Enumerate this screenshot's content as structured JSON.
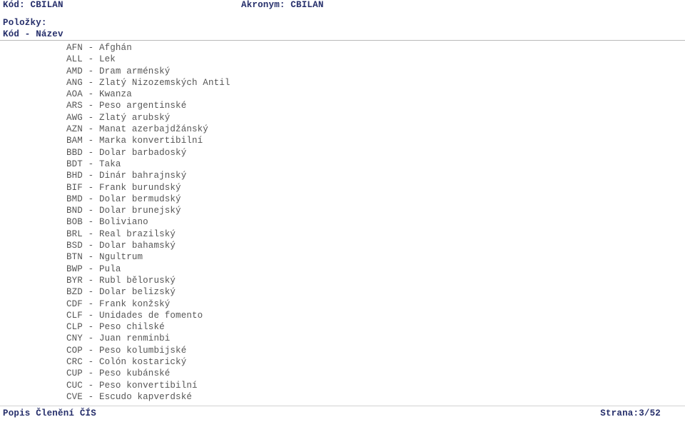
{
  "header": {
    "code_label": "Kód:",
    "code_value": "CBILAN",
    "code_line": "Kód: CBILAN",
    "acronym_label": "Akronym:",
    "acronym_value": "CBILAN",
    "acronym_line": "Akronym: CBILAN",
    "items_label": "Položky:",
    "column_header": "Kód - Název"
  },
  "items": [
    {
      "code": "AFN",
      "sep": " - ",
      "name": "Afghán",
      "text": "AFN - Afghán"
    },
    {
      "code": "ALL",
      "sep": " - ",
      "name": "Lek",
      "text": "ALL - Lek"
    },
    {
      "code": "AMD",
      "sep": " - ",
      "name": "Dram arménský",
      "text": "AMD - Dram arménský"
    },
    {
      "code": "ANG",
      "sep": " - ",
      "name": "Zlatý Nizozemských Antil",
      "text": "ANG - Zlatý Nizozemských Antil"
    },
    {
      "code": "AOA",
      "sep": " - ",
      "name": "Kwanza",
      "text": "AOA - Kwanza"
    },
    {
      "code": "ARS",
      "sep": " - ",
      "name": "Peso argentinské",
      "text": "ARS - Peso argentinské"
    },
    {
      "code": "AWG",
      "sep": " - ",
      "name": "Zlatý arubský",
      "text": "AWG - Zlatý arubský"
    },
    {
      "code": "AZN",
      "sep": " - ",
      "name": "Manat azerbajdžánský",
      "text": "AZN - Manat azerbajdžánský"
    },
    {
      "code": "BAM",
      "sep": " - ",
      "name": "Marka konvertibilní",
      "text": "BAM - Marka konvertibilní"
    },
    {
      "code": "BBD",
      "sep": " - ",
      "name": "Dolar barbadoský",
      "text": "BBD - Dolar barbadoský"
    },
    {
      "code": "BDT",
      "sep": " - ",
      "name": "Taka",
      "text": "BDT - Taka"
    },
    {
      "code": "BHD",
      "sep": " - ",
      "name": "Dinár bahrajnský",
      "text": "BHD - Dinár bahrajnský"
    },
    {
      "code": "BIF",
      "sep": " - ",
      "name": "Frank burundský",
      "text": "BIF - Frank burundský"
    },
    {
      "code": "BMD",
      "sep": " - ",
      "name": "Dolar bermudský",
      "text": "BMD - Dolar bermudský"
    },
    {
      "code": "BND",
      "sep": " - ",
      "name": "Dolar brunejský",
      "text": "BND - Dolar brunejský"
    },
    {
      "code": "BOB",
      "sep": " - ",
      "name": "Boliviano",
      "text": "BOB - Boliviano"
    },
    {
      "code": "BRL",
      "sep": " - ",
      "name": "Real brazilský",
      "text": "BRL - Real brazilský"
    },
    {
      "code": "BSD",
      "sep": " - ",
      "name": "Dolar bahamský",
      "text": "BSD - Dolar bahamský"
    },
    {
      "code": "BTN",
      "sep": " - ",
      "name": "Ngultrum",
      "text": "BTN - Ngultrum"
    },
    {
      "code": "BWP",
      "sep": " - ",
      "name": "Pula",
      "text": "BWP - Pula"
    },
    {
      "code": "BYR",
      "sep": " - ",
      "name": "Rubl běloruský",
      "text": "BYR - Rubl běloruský"
    },
    {
      "code": "BZD",
      "sep": " - ",
      "name": "Dolar belizský",
      "text": "BZD - Dolar belizský"
    },
    {
      "code": "CDF",
      "sep": " - ",
      "name": "Frank konžský",
      "text": "CDF - Frank konžský"
    },
    {
      "code": "CLF",
      "sep": " - ",
      "name": "Unidades de fomento",
      "text": "CLF - Unidades de fomento"
    },
    {
      "code": "CLP",
      "sep": " - ",
      "name": "Peso chilské",
      "text": "CLP - Peso chilské"
    },
    {
      "code": "CNY",
      "sep": " - ",
      "name": "Juan renminbi",
      "text": "CNY - Juan renminbi"
    },
    {
      "code": "COP",
      "sep": " - ",
      "name": "Peso kolumbijské",
      "text": "COP - Peso kolumbijské"
    },
    {
      "code": "CRC",
      "sep": " - ",
      "name": "Colón kostarický",
      "text": "CRC - Colón kostarický"
    },
    {
      "code": "CUP",
      "sep": " - ",
      "name": "Peso kubánské",
      "text": "CUP - Peso kubánské"
    },
    {
      "code": "CUC",
      "sep": " - ",
      "name": "Peso konvertibilní",
      "text": "CUC - Peso konvertibilní"
    },
    {
      "code": "CVE",
      "sep": " - ",
      "name": "Escudo kapverdské",
      "text": "CVE - Escudo kapverdské"
    }
  ],
  "footer": {
    "title": "Popis Členění ČÍS",
    "page": "Strana:3/52"
  },
  "colors": {
    "heading": "#262f6b",
    "body_text": "#565656",
    "rule": "#b9b9b9",
    "background": "#ffffff"
  }
}
